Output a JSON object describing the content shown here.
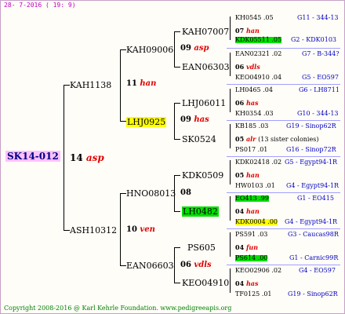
{
  "header": "28- 7-2016 ( 19: 9)",
  "footer": "Copyright 2008-2016 @ Karl Kehrle Foundation.    www.pedigreeapis.org",
  "root": {
    "id": "SK14-012"
  },
  "gen1": [
    {
      "id": "KAH1138",
      "q": "11",
      "c": "han"
    },
    {
      "id": "ASH10312",
      "q": "10",
      "c": "ven"
    }
  ],
  "root_q": {
    "q": "14",
    "c": "asp"
  },
  "gen2": [
    {
      "id": "KAH09006",
      "q": "09",
      "c": "asp"
    },
    {
      "id": "LHJ0925",
      "q": "09",
      "c": "has"
    },
    {
      "id": "HNO08013",
      "q": "08",
      "c": ""
    },
    {
      "id": "EAN06603",
      "q": "06",
      "c": "vdls"
    }
  ],
  "gen3": [
    {
      "id": "KAH07007",
      "q": "07",
      "c": "han"
    },
    {
      "id": "EAN06303",
      "q": "06",
      "c": "vdls"
    },
    {
      "id": "LHJ06011",
      "q": "06",
      "c": "has"
    },
    {
      "id": "SK0524",
      "q": "05",
      "c": "alr",
      "note": "(13 sister colonies)"
    },
    {
      "id": "KDK0509",
      "q": "05",
      "c": "han"
    },
    {
      "id": "LH0482",
      "q": "04",
      "c": "han"
    },
    {
      "id": "PS605",
      "q": "04",
      "c": "fun"
    },
    {
      "id": "KEO04910",
      "q": "04",
      "c": "has"
    }
  ],
  "gen4": [
    {
      "id": "KH0545 .05",
      "info": "G11 - 344-13"
    },
    {
      "id": "KDK05511 .05",
      "info": "G2 - KDK0103"
    },
    {
      "id": "EAN02321 .02",
      "info": "G7 - B-344?"
    },
    {
      "id": "KEO04910 .04",
      "info": "G5 - EO597"
    },
    {
      "id": "LH0465 .04",
      "info": "G6 - LH8711"
    },
    {
      "id": "KH0354 .03",
      "info": "G10 - 344-13"
    },
    {
      "id": "KB185 .03",
      "info": "G19 - Sinop62R"
    },
    {
      "id": "PS017 .01",
      "info": "G16 - Sinop72R"
    },
    {
      "id": "KDK02418 .02",
      "info": "G5 - Egypt94-1R"
    },
    {
      "id": "HW0103 .01",
      "info": "G4 - Egypt94-1R"
    },
    {
      "id": "EO413 .99",
      "info": "G1 - EO415"
    },
    {
      "id": "KDK0004 .00",
      "info": "G4 - Egypt94-1R"
    },
    {
      "id": "PS591 .03",
      "info": "G3 - Caucas98R"
    },
    {
      "id": "PS614 .00",
      "info": "G1 - Carnic99R"
    },
    {
      "id": "KEO02906 .02",
      "info": "G4 - EO597"
    },
    {
      "id": "TF0125 .01",
      "info": "G19 - Sinop62R"
    }
  ]
}
